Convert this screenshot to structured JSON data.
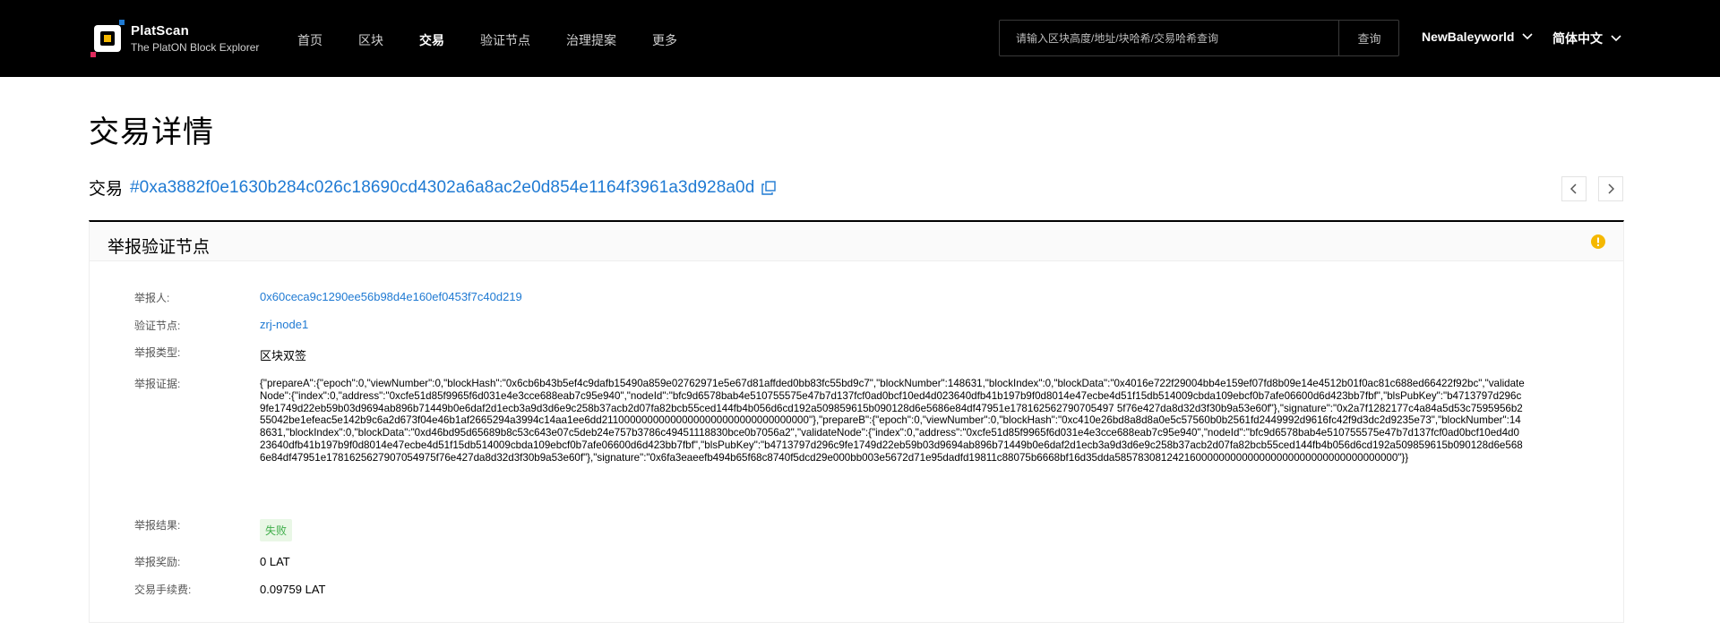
{
  "header": {
    "brand_name": "PlatScan",
    "brand_sub": "The PlatON Block Explorer",
    "nav": [
      "首页",
      "区块",
      "交易",
      "验证节点",
      "治理提案",
      "更多"
    ],
    "nav_active": "交易",
    "search_placeholder": "请输入区块高度/地址/块哈希/交易哈希查询",
    "search_button": "查询",
    "network": "NewBaleyworld",
    "language": "简体中文"
  },
  "page": {
    "title": "交易详情",
    "tx_label": "交易",
    "tx_hash": "#0xa3882f0e1630b284c026c18690cd4302a6a8ac2e0d854e1164f3961a3d928a0d"
  },
  "card": {
    "title": "举报验证节点",
    "rows": {
      "reporter_label": "举报人:",
      "reporter_value": "0x60ceca9c1290ee56b98d4e160ef0453f7c40d219",
      "node_label": "验证节点:",
      "node_value": "zrj-node1",
      "type_label": "举报类型:",
      "type_value": "区块双签",
      "evidence_label": "举报证据:",
      "evidence_value": "{\"prepareA\":{\"epoch\":0,\"viewNumber\":0,\"blockHash\":\"0x6cb6b43b5ef4c9dafb15490a859e02762971e5e67d81affded0bb83fc55bd9c7\",\"blockNumber\":148631,\"blockIndex\":0,\"blockData\":\"0x4016e722f29004bb4e159ef07fd8b09e14e4512b01f0ac81c688ed66422f92bc\",\"validateNode\":{\"index\":0,\"address\":\"0xcfe51d85f9965f6d031e4e3cce688eab7c95e940\",\"nodeId\":\"bfc9d6578bab4e510755575e47b7d137fcf0ad0bcf10ed4d023640dfb41b197b9f0d8014e47ecbe4d51f15db514009cbda109ebcf0b7afe06600d6d423bb7fbf\",\"blsPubKey\":\"b4713797d296c9fe1749d22eb59b03d9694ab896b71449b0e6daf2d1ecb3a9d3d6e9c258b37acb2d07fa82bcb55ced144fb4b056d6cd192a509859615b090128d6e5686e84df47951e178162562790705497 5f76e427da8d32d3f30b9a53e60f\"},\"signature\":\"0x2a7f1282177c4a84a5d53c7595956b255042be1efeac5e142b9c6a2d673f04e46b1af2665294a3994c14aa1ee6dd211000000000000000000000000000000000\"},\"prepareB\":{\"epoch\":0,\"viewNumber\":0,\"blockHash\":\"0xc410e26bd8a8d8a0e5c57560b0b2561fd2449992d9616fc42f9d3dc2d9235e73\",\"blockNumber\":148631,\"blockIndex\":0,\"blockData\":\"0xd46bd95d65689b8c53c643e07c5deb24e757b3786c49451118830bce0b7056a2\",\"validateNode\":{\"index\":0,\"address\":\"0xcfe51d85f9965f6d031e4e3cce688eab7c95e940\",\"nodeId\":\"bfc9d6578bab4e510755575e47b7d137fcf0ad0bcf10ed4d023640dfb41b197b9f0d8014e47ecbe4d51f15db514009cbda109ebcf0b7afe06600d6d423bb7fbf\",\"blsPubKey\":\"b4713797d296c9fe1749d22eb59b03d9694ab896b71449b0e6daf2d1ecb3a9d3d6e9c258b37acb2d07fa82bcb55ced144fb4b056d6cd192a509859615b090128d6e5686e84df47951e1781625627907054975f76e427da8d32d3f30b9a53e60f\"},\"signature\":\"0x6fa3eaeefb494b65f68c8740f5dcd29e000bb003e5672d71e95dadfd19811c88075b6668bf16d35dda5857830812421600000000000000000000000000000000000\"}}",
      "result_label": "举报结果:",
      "result_value": "失败",
      "reward_label": "举报奖励:",
      "reward_value": "0 LAT",
      "fee_label": "交易手续费:",
      "fee_value": "0.09759 LAT"
    }
  },
  "colors": {
    "header_bg": "#000000",
    "link": "#1f7ad3",
    "warn": "#f5b800",
    "fail_bg": "#e9f7e6",
    "fail_text": "#3fae4a"
  }
}
